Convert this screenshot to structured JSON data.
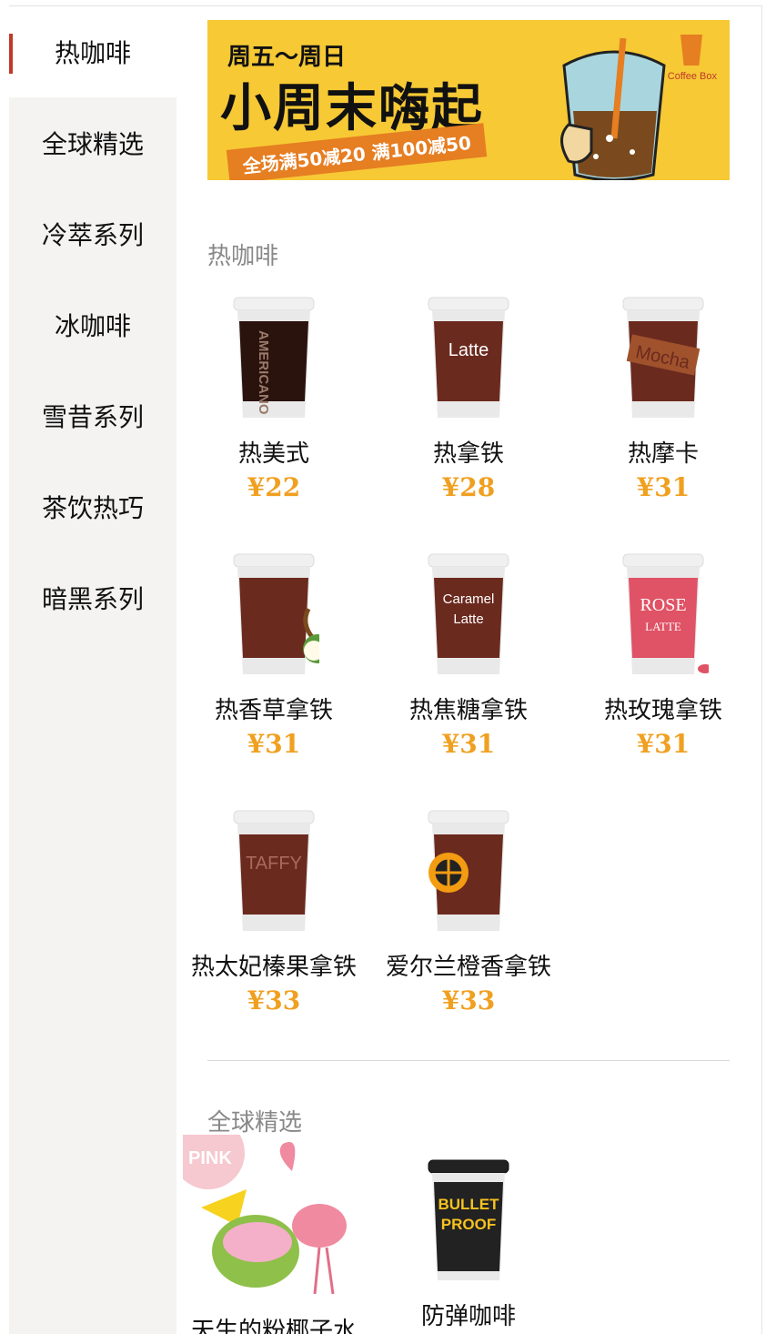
{
  "sidebar": {
    "items": [
      {
        "label": "热咖啡",
        "active": true
      },
      {
        "label": "全球精选",
        "active": false
      },
      {
        "label": "冷萃系列",
        "active": false
      },
      {
        "label": "冰咖啡",
        "active": false
      },
      {
        "label": "雪昔系列",
        "active": false
      },
      {
        "label": "茶饮热巧",
        "active": false
      },
      {
        "label": "暗黑系列",
        "active": false
      }
    ]
  },
  "banner": {
    "subtitle": "周五～周日",
    "title": "小周末嗨起",
    "promo": "全场满50减20 满100减50",
    "brand": "Coffee Box"
  },
  "sections": [
    {
      "title": "热咖啡",
      "products": [
        {
          "name": "热美式",
          "price": "¥22",
          "cup_text": "AMERICANO",
          "cup_color": "#3a1a12"
        },
        {
          "name": "热拿铁",
          "price": "¥28",
          "cup_text": "Latte",
          "cup_color": "#6b2a1e"
        },
        {
          "name": "热摩卡",
          "price": "¥31",
          "cup_text": "Mocha",
          "cup_color": "#6b2a1e"
        },
        {
          "name": "热香草拿铁",
          "price": "¥31",
          "cup_text": "",
          "cup_color": "#6b2a1e"
        },
        {
          "name": "热焦糖拿铁",
          "price": "¥31",
          "cup_text": "Caramel Latte",
          "cup_color": "#6b2a1e"
        },
        {
          "name": "热玫瑰拿铁",
          "price": "¥31",
          "cup_text": "ROSE LATTE",
          "cup_color": "#e05265"
        },
        {
          "name": "热太妃榛果拿铁",
          "price": "¥33",
          "cup_text": "TAFFY",
          "cup_color": "#6b2a1e"
        },
        {
          "name": "爱尔兰橙香拿铁",
          "price": "¥33",
          "cup_text": "",
          "cup_color": "#6b2a1e"
        }
      ]
    },
    {
      "title": "全球精选",
      "products": [
        {
          "name": "天生的粉椰子水",
          "badge": "PINK"
        },
        {
          "name": "防弹咖啡",
          "cup_text": "BULLET PROOF",
          "cup_color": "#222222"
        }
      ]
    }
  ]
}
